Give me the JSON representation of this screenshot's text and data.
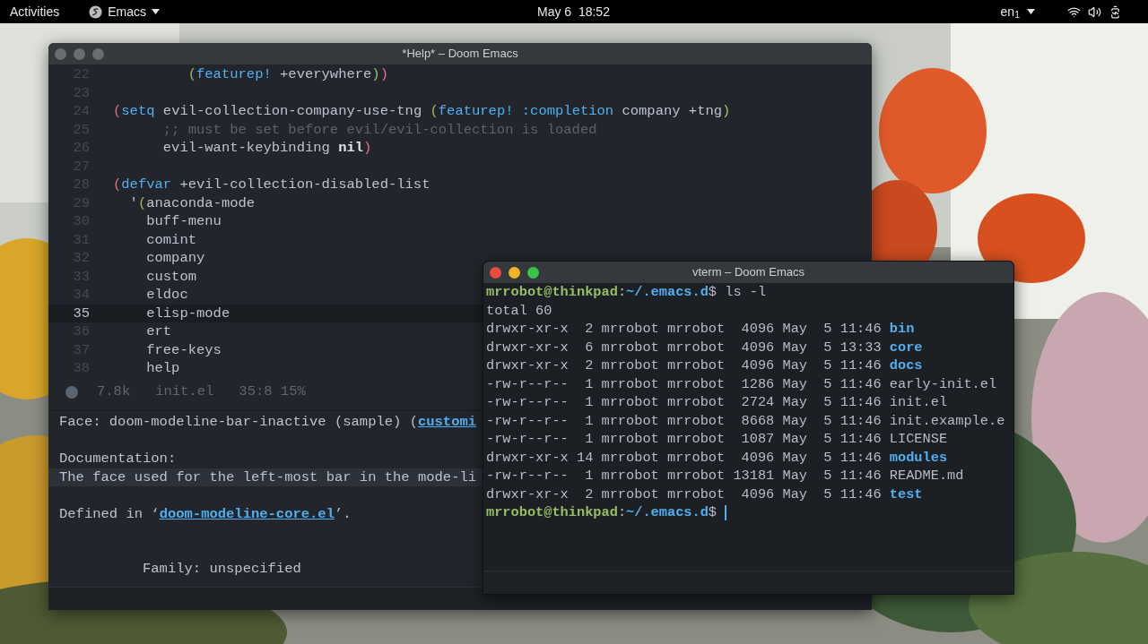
{
  "top_bar": {
    "activities": "Activities",
    "app_menu": "Emacs",
    "clock": "May 6  18:52",
    "keyboard_layout": "en$_{1}$"
  },
  "editor_window": {
    "title": "*Help* – Doom Emacs",
    "active": false,
    "code_lines": [
      {
        "number": "22",
        "current": false,
        "tokens": [
          {
            "text": "         (",
            "kind": "paren-inner"
          },
          {
            "text": "featurep!",
            "kind": "keyword"
          },
          {
            "text": " +everywhere",
            "kind": "text"
          },
          {
            "text": ")",
            "kind": "paren-inner"
          },
          {
            "text": ")",
            "kind": "paren-outer"
          }
        ]
      },
      {
        "number": "23",
        "current": false
      },
      {
        "number": "24",
        "current": false,
        "tokens": [
          {
            "text": "(",
            "kind": "paren-outer"
          },
          {
            "text": "setq",
            "kind": "keyword"
          },
          {
            "text": " evil-collection-company-use-tng ",
            "kind": "text"
          },
          {
            "text": "(",
            "kind": "paren-inner"
          },
          {
            "text": "featurep!",
            "kind": "keyword"
          },
          {
            "text": " :completion",
            "kind": "keyword"
          },
          {
            "text": " company +tng",
            "kind": "text"
          },
          {
            "text": ")",
            "kind": "paren-inner"
          }
        ]
      },
      {
        "number": "25",
        "current": false,
        "tokens": [
          {
            "text": "      ;; must be set before evil/evil-collection is loaded",
            "kind": "comment"
          }
        ]
      },
      {
        "number": "26",
        "current": false,
        "tokens": [
          {
            "text": "      evil-want-keybinding ",
            "kind": "text"
          },
          {
            "text": "nil",
            "kind": "constant"
          },
          {
            "text": ")",
            "kind": "paren-outer"
          }
        ]
      },
      {
        "number": "27",
        "current": false
      },
      {
        "number": "28",
        "current": false,
        "tokens": [
          {
            "text": "(",
            "kind": "paren-outer"
          },
          {
            "text": "defvar",
            "kind": "keyword"
          },
          {
            "text": " +evil-collection-disabled-list",
            "kind": "text"
          }
        ]
      },
      {
        "number": "29",
        "current": false,
        "tokens": [
          {
            "text": "  '",
            "kind": "text"
          },
          {
            "text": "(",
            "kind": "paren-inner"
          },
          {
            "text": "anaconda-mode",
            "kind": "text"
          }
        ]
      },
      {
        "number": "30",
        "current": false,
        "tokens": [
          {
            "text": "    buff-menu",
            "kind": "text"
          }
        ]
      },
      {
        "number": "31",
        "current": false,
        "tokens": [
          {
            "text": "    comint",
            "kind": "text"
          }
        ]
      },
      {
        "number": "32",
        "current": false,
        "tokens": [
          {
            "text": "    company",
            "kind": "text"
          }
        ]
      },
      {
        "number": "33",
        "current": false,
        "tokens": [
          {
            "text": "    custom",
            "kind": "text"
          }
        ]
      },
      {
        "number": "34",
        "current": false,
        "tokens": [
          {
            "text": "    eldoc",
            "kind": "text"
          }
        ]
      },
      {
        "number": "35",
        "current": true,
        "tokens": [
          {
            "text": "    elisp-mode",
            "kind": "text"
          }
        ]
      },
      {
        "number": "36",
        "current": false,
        "tokens": [
          {
            "text": "    ert",
            "kind": "text"
          }
        ]
      },
      {
        "number": "37",
        "current": false,
        "tokens": [
          {
            "text": "    free-keys",
            "kind": "text"
          }
        ]
      },
      {
        "number": "38",
        "current": false,
        "tokens": [
          {
            "text": "    help",
            "kind": "text"
          }
        ]
      }
    ],
    "modeline": {
      "size": "7.8k",
      "buffer": "init.el",
      "position": "35:8 15%"
    },
    "help_lines": [
      {
        "kind": "line",
        "current": false,
        "parts": [
          {
            "text": "Face: doom-modeline-bar-inactive (sample) (",
            "kind": "text"
          },
          {
            "text": "customi",
            "kind": "link"
          }
        ]
      },
      {
        "kind": "blank",
        "current": false
      },
      {
        "kind": "line",
        "current": false,
        "parts": [
          {
            "text": "Documentation:",
            "kind": "text"
          }
        ]
      },
      {
        "kind": "line",
        "current": true,
        "parts": [
          {
            "text": "The face used for the left-most bar in the mode-li",
            "kind": "text"
          }
        ]
      },
      {
        "kind": "blank",
        "current": false
      },
      {
        "kind": "line",
        "current": false,
        "parts": [
          {
            "text": "Defined in ‘",
            "kind": "text"
          },
          {
            "text": "doom-modeline-core.el",
            "kind": "link"
          },
          {
            "text": "’.",
            "kind": "text"
          }
        ]
      },
      {
        "kind": "blank",
        "current": false
      },
      {
        "kind": "blank",
        "current": false
      },
      {
        "kind": "line",
        "current": false,
        "parts": [
          {
            "text": "          Family: unspecified",
            "kind": "text"
          }
        ]
      }
    ]
  },
  "terminal_window": {
    "title": "vterm – Doom Emacs",
    "active": true,
    "lines": [
      {
        "kind": "prompt",
        "user": "mrrobot@thinkpad",
        "separator": ":",
        "path": "~/.emacs.d",
        "command": "$ ls -l",
        "cursor": false
      },
      {
        "kind": "output",
        "info": "total 60"
      },
      {
        "kind": "entry",
        "info": "drwxr-xr-x  2 mrrobot mrrobot  4096 May  5 11:46",
        "name": "bin",
        "directory": true
      },
      {
        "kind": "entry",
        "info": "drwxr-xr-x  6 mrrobot mrrobot  4096 May  5 13:33",
        "name": "core",
        "directory": true
      },
      {
        "kind": "entry",
        "info": "drwxr-xr-x  2 mrrobot mrrobot  4096 May  5 11:46",
        "name": "docs",
        "directory": true
      },
      {
        "kind": "entry",
        "info": "-rw-r--r--  1 mrrobot mrrobot  1286 May  5 11:46",
        "name": "early-init.el",
        "directory": false
      },
      {
        "kind": "entry",
        "info": "-rw-r--r--  1 mrrobot mrrobot  2724 May  5 11:46",
        "name": "init.el",
        "directory": false
      },
      {
        "kind": "entry",
        "info": "-rw-r--r--  1 mrrobot mrrobot  8668 May  5 11:46",
        "name": "init.example.e",
        "directory": false
      },
      {
        "kind": "entry",
        "info": "-rw-r--r--  1 mrrobot mrrobot  1087 May  5 11:46",
        "name": "LICENSE",
        "directory": false
      },
      {
        "kind": "entry",
        "info": "drwxr-xr-x 14 mrrobot mrrobot  4096 May  5 11:46",
        "name": "modules",
        "directory": true
      },
      {
        "kind": "entry",
        "info": "-rw-r--r--  1 mrrobot mrrobot 13181 May  5 11:46",
        "name": "README.md",
        "directory": false
      },
      {
        "kind": "entry",
        "info": "drwxr-xr-x  2 mrrobot mrrobot  4096 May  5 11:46",
        "name": "test",
        "directory": true
      },
      {
        "kind": "prompt",
        "user": "mrrobot@thinkpad",
        "separator": ":",
        "path": "~/.emacs.d",
        "command": "$ ",
        "cursor": true
      }
    ]
  }
}
